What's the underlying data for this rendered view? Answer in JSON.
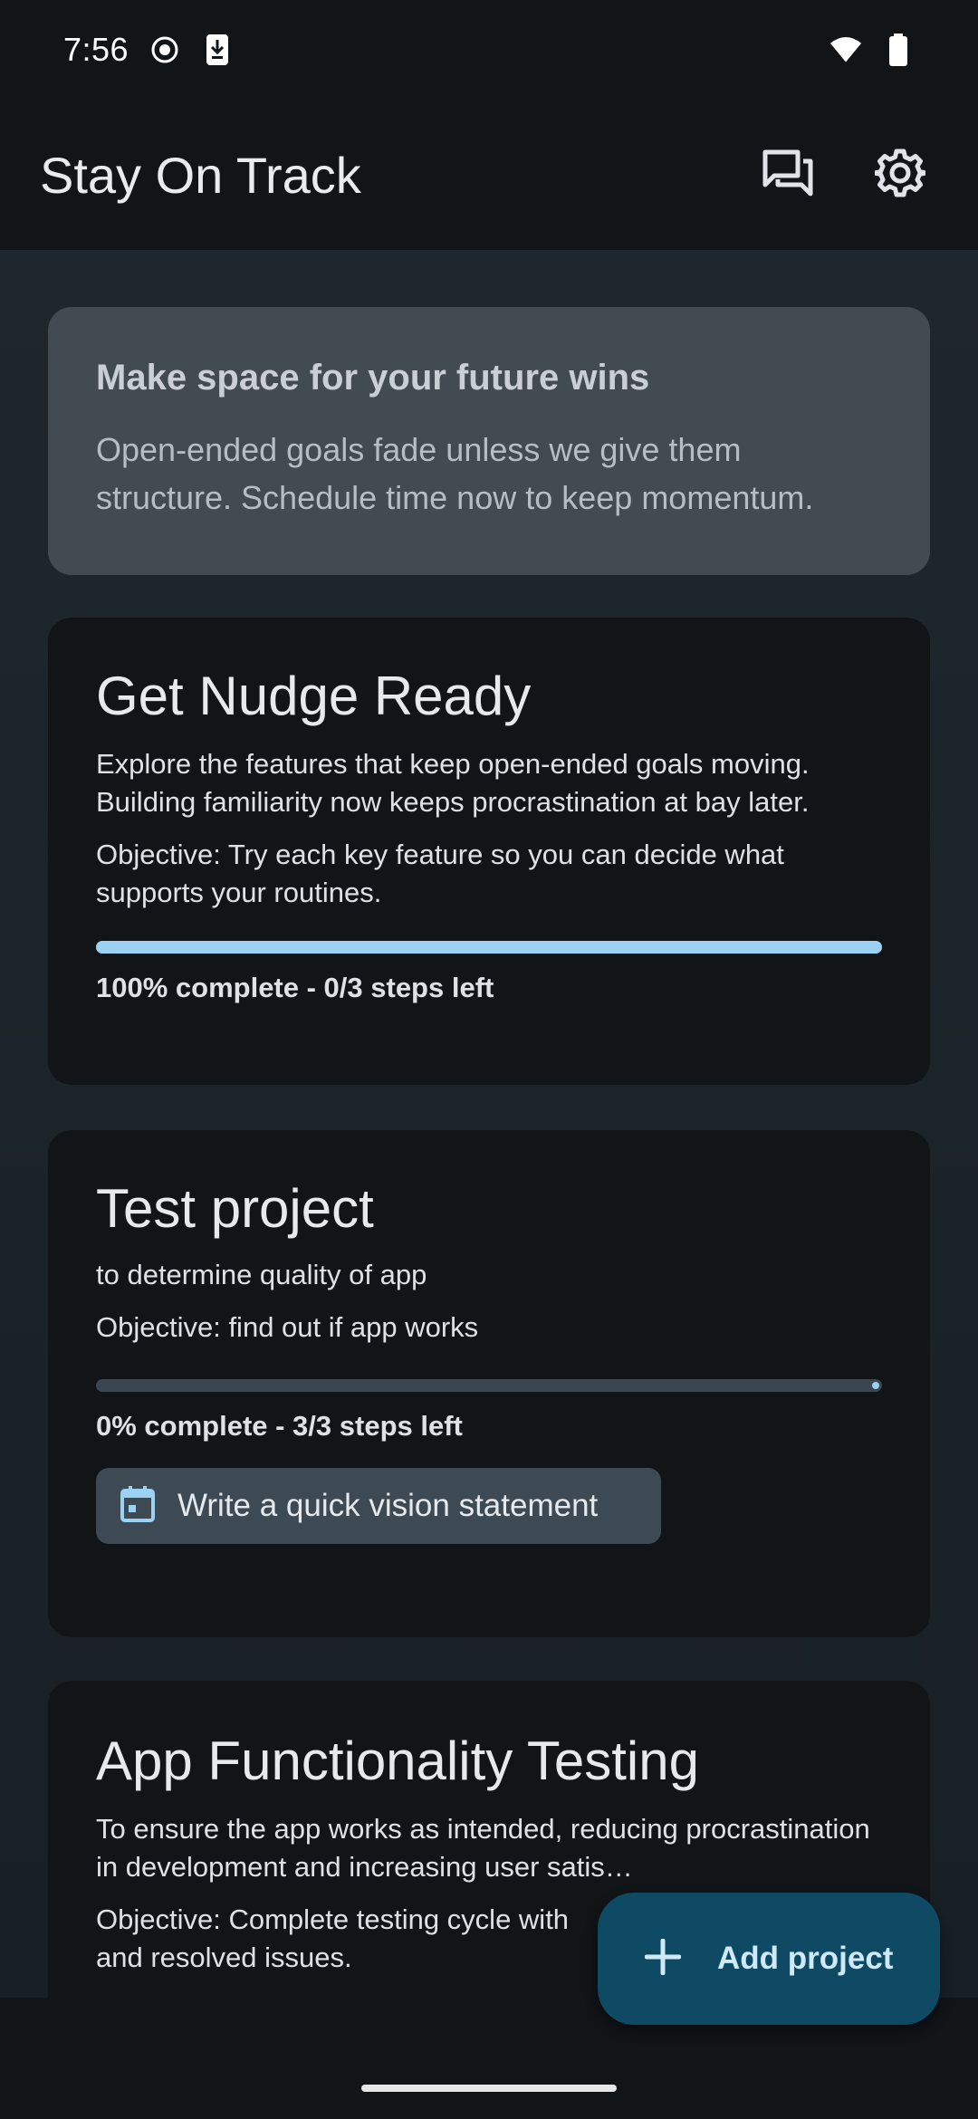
{
  "status_bar": {
    "time": "7:56"
  },
  "app_bar": {
    "title": "Stay On Track",
    "actions": [
      "feedback-icon",
      "settings-icon"
    ]
  },
  "banner": {
    "title": "Make space for your future wins",
    "body": "Open-ended goals fade unless we give them structure. Schedule time now to keep momentum."
  },
  "projects": [
    {
      "title": "Get Nudge Ready",
      "description": "Explore the features that keep open-ended goals moving. Building familiarity now keeps procrastination at bay later.",
      "objective": "Objective: Try each key feature so you can decide what supports your routines.",
      "progress_fraction": 1.0,
      "progress_label": "100% complete - 0/3 steps left"
    },
    {
      "title": "Test project",
      "description": "to determine quality of app",
      "objective": "Objective: find out if app works",
      "progress_fraction": 0.0,
      "progress_label": "0% complete - 3/3 steps left",
      "action_label": "Write a quick vision statement"
    },
    {
      "title": "App Functionality Testing",
      "description": "To ensure the app works as intended, reducing procrastination in development and increasing user satis…",
      "objective": "Objective: Complete testing cycle with and resolved issues."
    }
  ],
  "fab": {
    "label": "Add project"
  },
  "colors": {
    "accent": "#9bd1f2",
    "fab_bg": "#0e4a63",
    "card_bg": "#111518",
    "banner_bg": "#434b52"
  }
}
